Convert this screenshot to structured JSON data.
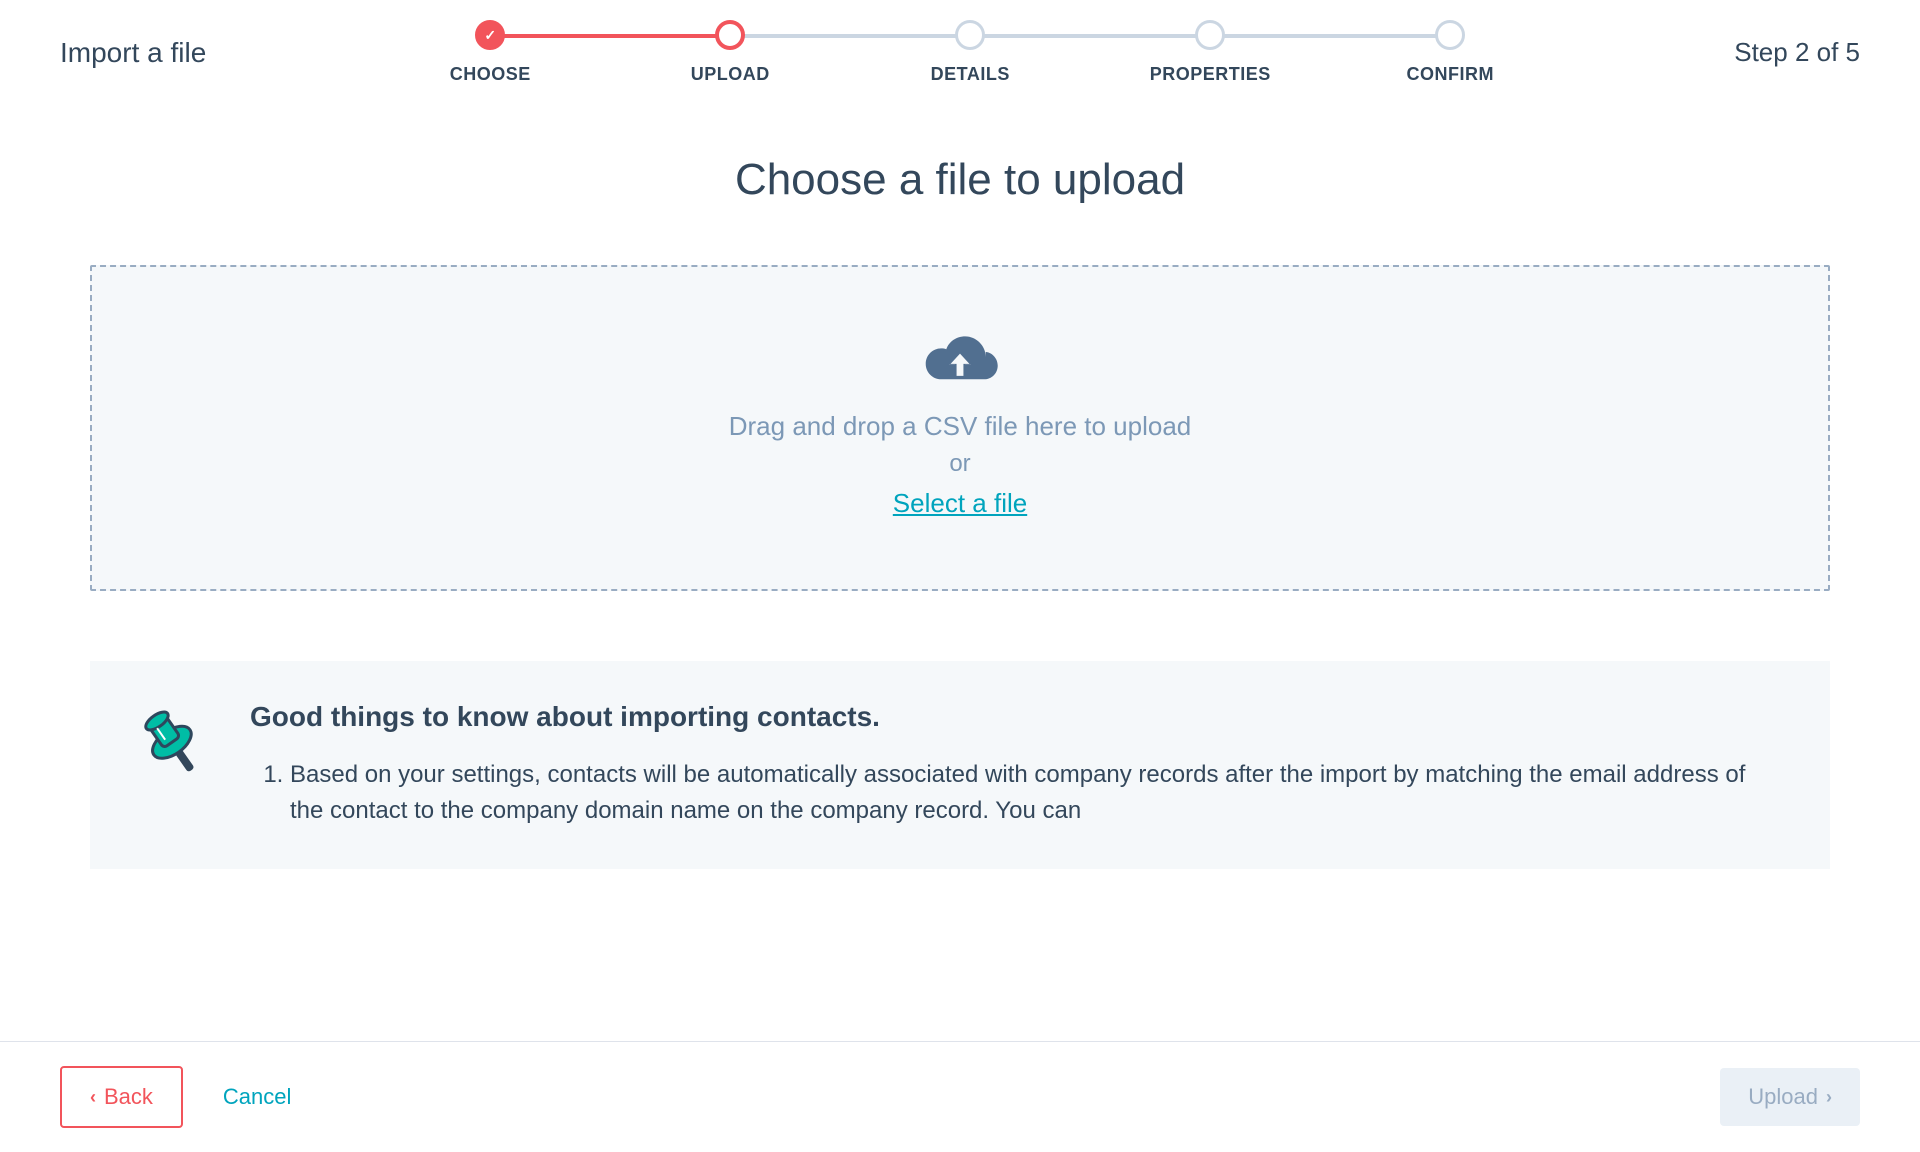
{
  "header": {
    "title": "Import a file",
    "step_label": "Step 2 of 5"
  },
  "stepper": {
    "steps": [
      {
        "label": "CHOOSE"
      },
      {
        "label": "UPLOAD"
      },
      {
        "label": "DETAILS"
      },
      {
        "label": "PROPERTIES"
      },
      {
        "label": "CONFIRM"
      }
    ]
  },
  "main": {
    "title": "Choose a file to upload",
    "dropzone": {
      "drag_text": "Drag and drop a CSV file here to upload",
      "or_text": "or",
      "select_link": "Select a file"
    }
  },
  "info": {
    "heading": "Good things to know about importing contacts.",
    "item1": "Based on your settings, contacts will be automatically associated with company records after the import by matching the email address of the contact to the company domain name on the company record. You can"
  },
  "footer": {
    "back": "Back",
    "cancel": "Cancel",
    "upload": "Upload"
  }
}
